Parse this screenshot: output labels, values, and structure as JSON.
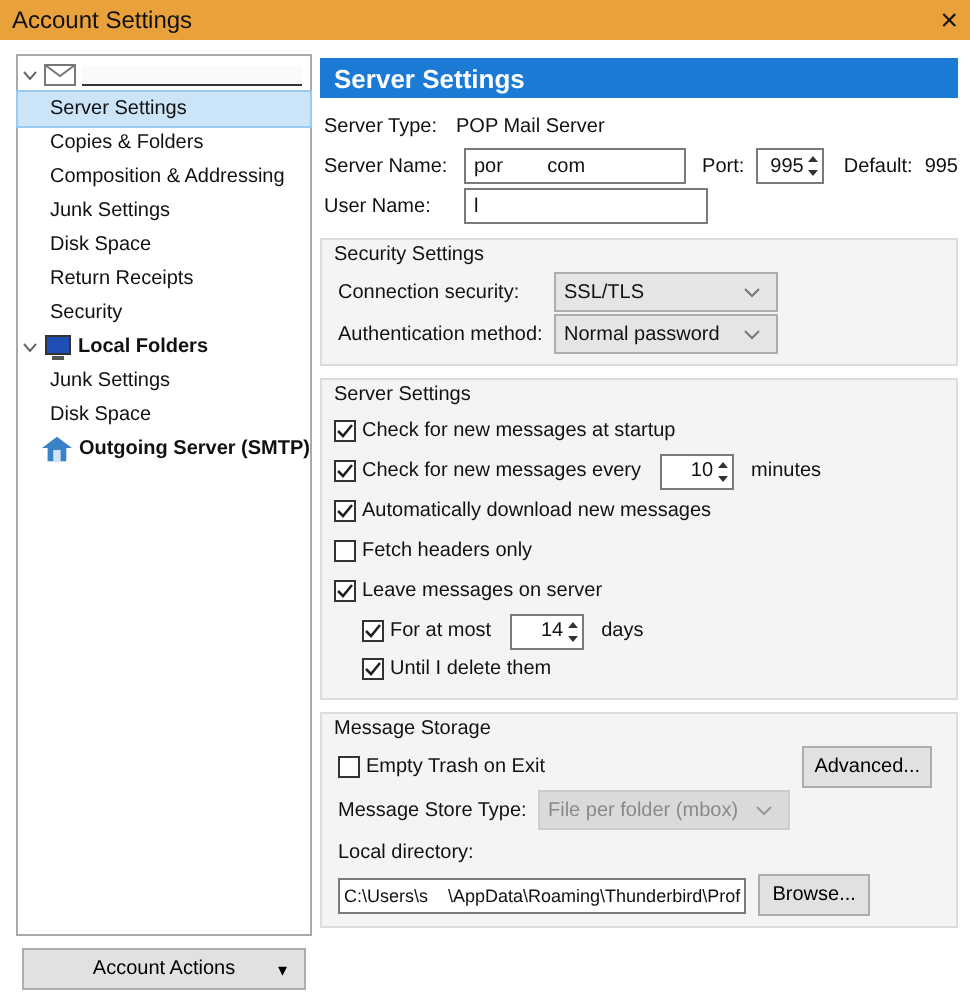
{
  "window": {
    "title": "Account Settings",
    "close": "×"
  },
  "sidebar": {
    "items": [
      {
        "kind": "account",
        "expanded": true,
        "selected": false,
        "children": [
          {
            "label": "Server Settings",
            "selected": true
          },
          {
            "label": "Copies & Folders",
            "selected": false
          },
          {
            "label": "Composition & Addressing",
            "selected": false
          },
          {
            "label": "Junk Settings",
            "selected": false
          },
          {
            "label": "Disk Space",
            "selected": false
          },
          {
            "label": "Return Receipts",
            "selected": false
          },
          {
            "label": "Security",
            "selected": false
          }
        ]
      },
      {
        "kind": "local",
        "label": "Local Folders",
        "expanded": true,
        "selected": false,
        "children": [
          {
            "label": "Junk Settings",
            "selected": false
          },
          {
            "label": "Disk Space",
            "selected": false
          }
        ]
      },
      {
        "kind": "smtp",
        "label": "Outgoing Server (SMTP)",
        "selected": false
      }
    ],
    "account_actions": {
      "label": "Account Actions",
      "caret": "▾"
    }
  },
  "header": "Server Settings",
  "server_type": {
    "label": "Server Type:",
    "value": "POP Mail Server"
  },
  "server_name": {
    "label": "Server Name:",
    "value": "por        com"
  },
  "port": {
    "label": "Port:",
    "value": "995",
    "default_label": "Default:",
    "default_value": "995"
  },
  "user_name": {
    "label": "User Name:",
    "value": "l"
  },
  "security": {
    "title": "Security Settings",
    "fields": [
      {
        "label": "Connection security:",
        "value": "SSL/TLS"
      },
      {
        "label": "Authentication method:",
        "value": "Normal password"
      }
    ]
  },
  "server_settings": {
    "title": "Server Settings",
    "options": [
      {
        "kind": "checkbox",
        "label": "Check for new messages at startup",
        "checked": true
      },
      {
        "kind": "spinner",
        "label": "Check for new messages every",
        "checked": true,
        "value": "10",
        "unit": "minutes"
      },
      {
        "kind": "checkbox",
        "label": "Automatically download new messages",
        "checked": true
      },
      {
        "kind": "checkbox",
        "label": "Fetch headers only",
        "checked": false
      },
      {
        "kind": "checkbox",
        "label": "Leave messages on server",
        "checked": true,
        "children": [
          {
            "kind": "spinner",
            "label": "For at most",
            "checked": true,
            "value": "14",
            "unit": "days"
          },
          {
            "kind": "checkbox",
            "label": "Until I delete them",
            "checked": true
          }
        ]
      }
    ]
  },
  "storage": {
    "title": "Message Storage",
    "empty_trash": {
      "label": "Empty Trash on Exit",
      "checked": false
    },
    "advanced": "Advanced...",
    "store_type": {
      "label": "Message Store Type:",
      "value": "File per folder (mbox)",
      "disabled": true
    },
    "local_dir": {
      "label": "Local directory:",
      "value": "C:\\Users\\s    \\AppData\\Roaming\\Thunderbird\\Prof"
    },
    "browse": "Browse..."
  }
}
